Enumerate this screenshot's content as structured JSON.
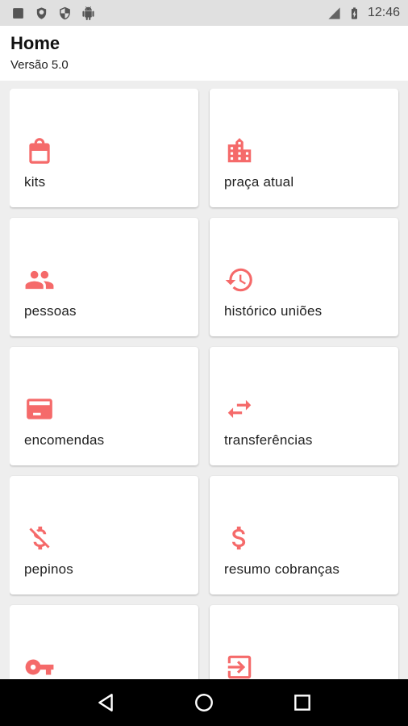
{
  "status_bar": {
    "time": "12:46",
    "left_icons": [
      "notification-square-icon",
      "shield-outline-icon",
      "shield-filled-icon",
      "android-icon"
    ],
    "right_icons": [
      "signal-lte-icon",
      "battery-charging-icon"
    ]
  },
  "header": {
    "title": "Home",
    "subtitle": "Versão 5.0"
  },
  "accent_color": "#f56a6a",
  "menu": [
    {
      "label": "kits",
      "icon": "shopping-bag-icon"
    },
    {
      "label": "praça atual",
      "icon": "building-icon"
    },
    {
      "label": "pessoas",
      "icon": "people-icon"
    },
    {
      "label": "histórico uniões",
      "icon": "history-icon"
    },
    {
      "label": "encomendas",
      "icon": "package-icon"
    },
    {
      "label": "transferências",
      "icon": "swap-arrows-icon"
    },
    {
      "label": "pepinos",
      "icon": "money-off-icon"
    },
    {
      "label": "resumo cobranças",
      "icon": "dollar-icon"
    },
    {
      "label": "",
      "icon": "key-icon"
    },
    {
      "label": "",
      "icon": "logout-icon"
    }
  ],
  "nav_bar": {
    "buttons": [
      "back-icon",
      "home-icon",
      "recents-icon"
    ]
  }
}
